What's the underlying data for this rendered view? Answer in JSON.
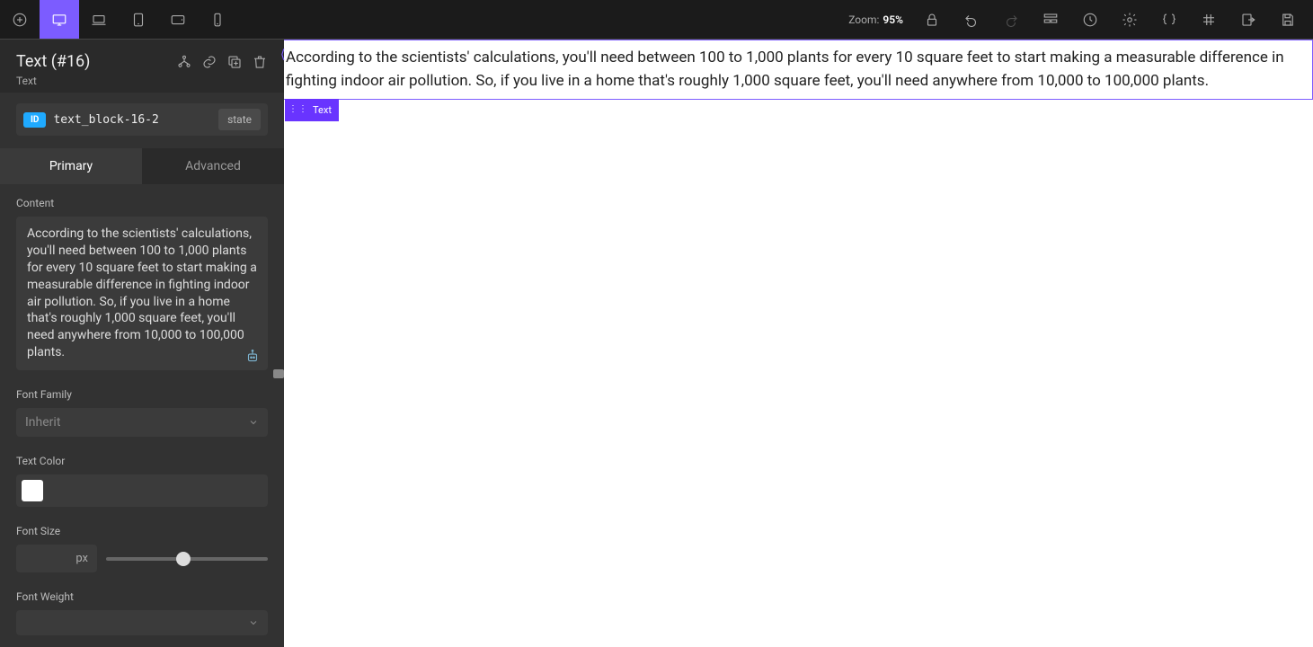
{
  "toolbar": {
    "zoom_label": "Zoom:",
    "zoom_value": "95%"
  },
  "sidebar": {
    "title": "Text (#16)",
    "subtitle": "Text",
    "id_badge": "ID",
    "id_text": "text_block-16-2",
    "state_label": "state",
    "tabs": {
      "primary": "Primary",
      "advanced": "Advanced"
    },
    "sections": {
      "content_label": "Content",
      "content_text": "According to the scientists' calculations, you'll need between 100 to 1,000 plants for every 10 square feet to start making a measurable difference in fighting indoor air pollution. So, if you live in a home that's roughly 1,000 square feet, you'll need anywhere from 10,000 to 100,000 plants.",
      "font_family_label": "Font Family",
      "font_family_value": "Inherit",
      "text_color_label": "Text Color",
      "text_color_value": "#ffffff",
      "font_size_label": "Font Size",
      "font_size_unit": "px",
      "font_size_slider_pct": 48,
      "font_weight_label": "Font Weight"
    }
  },
  "canvas": {
    "text": "According to the scientists' calculations, you'll need between 100 to 1,000 plants for every 10 square feet to start making a measurable difference in fighting indoor air pollution. So, if you live in a home that's roughly 1,000 square feet, you'll need anywhere from 10,000 to 100,000 plants.",
    "chip_label": "Text"
  }
}
